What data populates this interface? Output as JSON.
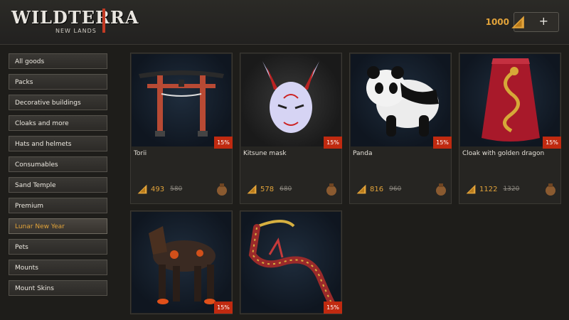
{
  "header": {
    "logo_main": "WILDTERRA",
    "logo_sub": "NEW LANDS",
    "currency_amount": "1000",
    "add_currency_label": "+"
  },
  "sidebar": {
    "items": [
      {
        "label": "All goods"
      },
      {
        "label": "Packs"
      },
      {
        "label": "Decorative buildings"
      },
      {
        "label": "Cloaks and more"
      },
      {
        "label": "Hats and helmets"
      },
      {
        "label": "Consumables"
      },
      {
        "label": "Sand Temple"
      },
      {
        "label": "Premium"
      },
      {
        "label": "Lunar New Year"
      },
      {
        "label": "Pets"
      },
      {
        "label": "Mounts"
      },
      {
        "label": "Mount Skins"
      }
    ],
    "active_index": 8
  },
  "products": [
    {
      "name": "Torii",
      "discount": "15%",
      "price": "493",
      "old_price": "580",
      "icon": "torii-gate-image"
    },
    {
      "name": "Kitsune mask",
      "discount": "15%",
      "price": "578",
      "old_price": "680",
      "icon": "kitsune-mask-image"
    },
    {
      "name": "Panda",
      "discount": "15%",
      "price": "816",
      "old_price": "960",
      "icon": "panda-image"
    },
    {
      "name": "Cloak with golden dragon",
      "discount": "15%",
      "price": "1122",
      "old_price": "1320",
      "icon": "dragon-cloak-image"
    },
    {
      "name": "",
      "discount": "15%",
      "price": "",
      "old_price": "",
      "icon": "armored-horse-image"
    },
    {
      "name": "",
      "discount": "15%",
      "price": "",
      "old_price": "",
      "icon": "dragon-mount-skin-image"
    }
  ],
  "colors": {
    "accent": "#e2a33a",
    "badge": "#c02a10",
    "background": "#1e1d1a"
  }
}
